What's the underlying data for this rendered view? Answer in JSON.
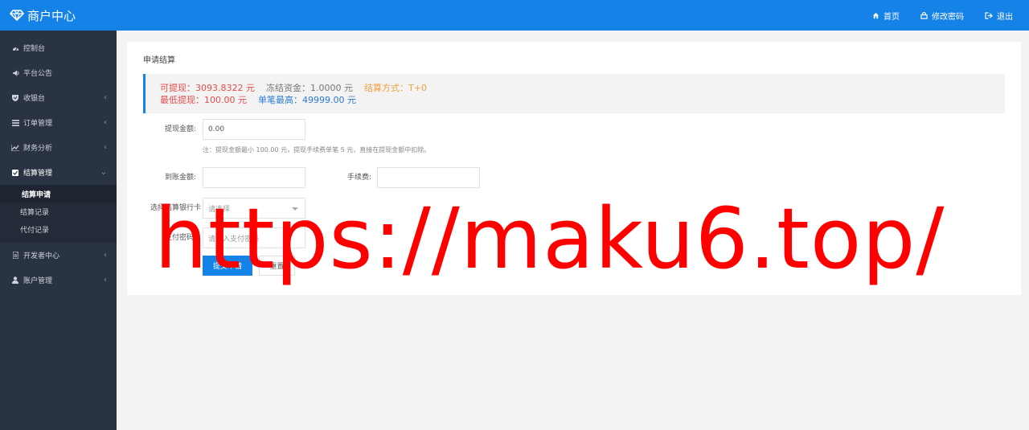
{
  "header": {
    "title": "商户中心",
    "actions": [
      {
        "label": "首页",
        "icon": "home-icon"
      },
      {
        "label": "修改密码",
        "icon": "lock-icon"
      },
      {
        "label": "退出",
        "icon": "logout-icon"
      }
    ]
  },
  "sidebar": {
    "items": [
      {
        "label": "控制台",
        "icon": "dashboard-icon"
      },
      {
        "label": "平台公告",
        "icon": "megaphone-icon"
      },
      {
        "label": "收银台",
        "icon": "shield-icon"
      },
      {
        "label": "订单管理",
        "icon": "list-icon"
      },
      {
        "label": "财务分析",
        "icon": "chart-icon"
      },
      {
        "label": "结算管理",
        "icon": "check-square-icon"
      },
      {
        "label": "开发者中心",
        "icon": "file-icon"
      },
      {
        "label": "账户管理",
        "icon": "user-icon"
      }
    ],
    "sub_items": [
      {
        "label": "结算申请",
        "active": true
      },
      {
        "label": "结算记录"
      },
      {
        "label": "代付记录"
      }
    ]
  },
  "main": {
    "title": "申请结算",
    "info": {
      "available": "可提现：3093.8322 元",
      "frozen": "冻结资金：1.0000 元",
      "method": "结算方式：T+0",
      "min": "最低提现：100.00 元",
      "max": "单笔最高：49999.00 元"
    },
    "form": {
      "amount_label": "提现金额:",
      "amount_value": "0.00",
      "note": "注：提现金额最小 100.00 元，提现手续费单笔 5 元，直接在提现金额中扣除。",
      "received_label": "到账金额:",
      "fee_label": "手续费:",
      "bank_label": "选择结算银行卡",
      "bank_placeholder": "请选择",
      "password_label": "支付密码:",
      "password_placeholder": "请输入支付密码",
      "submit_label": "提交申请",
      "reset_label": "重置"
    }
  },
  "watermark": "https://maku6.top/",
  "colors": {
    "accent": "#1582e8",
    "sidebar": "#2a3344",
    "available": "#e64b4b",
    "method": "#f0a03a",
    "max": "#2b7bd0"
  }
}
